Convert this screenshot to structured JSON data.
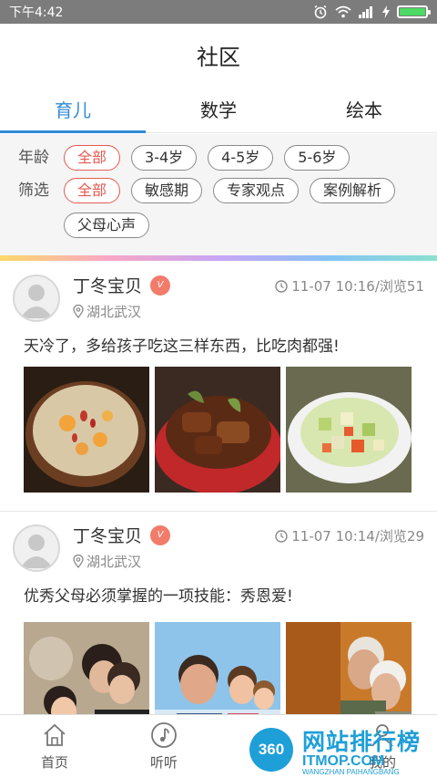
{
  "status_bar": {
    "time": "下午4:42"
  },
  "header": {
    "title": "社区"
  },
  "tabs": [
    {
      "label": "育儿",
      "active": true
    },
    {
      "label": "数学",
      "active": false
    },
    {
      "label": "绘本",
      "active": false
    }
  ],
  "filters": {
    "age": {
      "label": "年龄",
      "options": [
        "全部",
        "3-4岁",
        "4-5岁",
        "5-6岁"
      ],
      "selected": "全部"
    },
    "topic": {
      "label": "筛选",
      "options": [
        "全部",
        "敏感期",
        "专家观点",
        "案例解析",
        "父母心声"
      ],
      "selected": "全部"
    }
  },
  "posts": [
    {
      "author": "丁冬宝贝",
      "badge": "V",
      "meta": "11-07 10:16/浏览51",
      "location": "湖北武汉",
      "text": "天冷了，多给孩子吃这三样东西，比吃肉都强!",
      "photos": [
        "porridge-photo",
        "braised-pork-ribs-photo",
        "vegetable-dish-photo"
      ]
    },
    {
      "author": "丁冬宝贝",
      "badge": "V",
      "meta": "11-07 10:14/浏览29",
      "location": "湖北武汉",
      "text": "优秀父母必须掌握的一项技能：秀恩爱!",
      "photos": [
        "family-kiss-photo",
        "father-children-photo",
        "elderly-couple-photo"
      ]
    }
  ],
  "bottom_nav": [
    {
      "label": "首页",
      "icon": "home-icon"
    },
    {
      "label": "听听",
      "icon": "music-note-icon"
    },
    {
      "label": "",
      "icon": "community-icon"
    },
    {
      "label": "我的",
      "icon": "profile-icon"
    }
  ],
  "watermark": {
    "circle_text": "360",
    "title": "网站排行榜",
    "url": "ITMOP.COM",
    "sub": "WANGZHAN PAIHANGBANG"
  },
  "colors": {
    "accent_blue": "#2f8bd6",
    "active_chip_red": "#e55a52",
    "status_bar": "#7c7c7c",
    "vip_badge": "#f27b6a"
  }
}
